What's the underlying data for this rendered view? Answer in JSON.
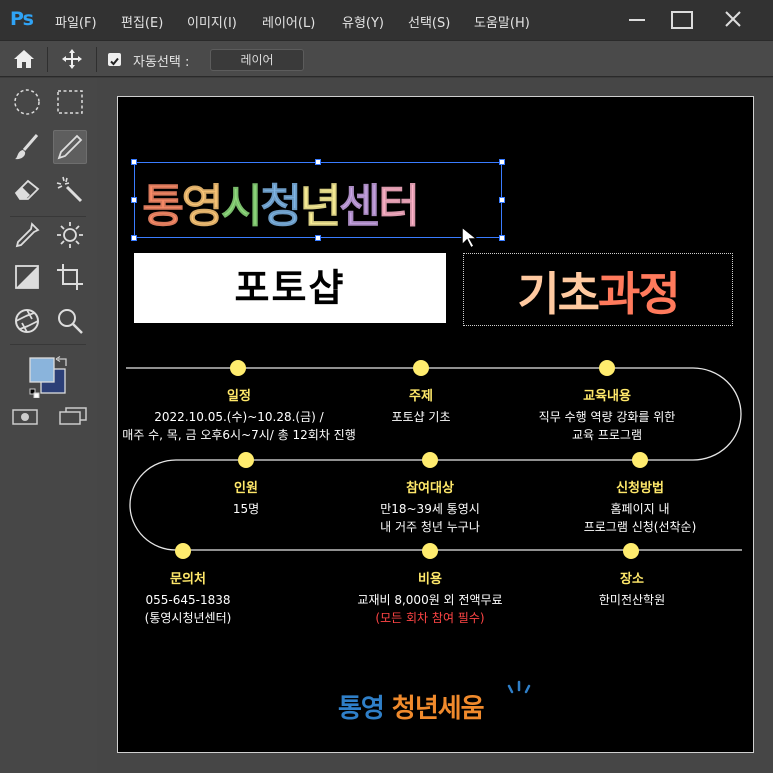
{
  "app": {
    "logo": "Ps"
  },
  "menu": [
    "파일(F)",
    "편집(E)",
    "이미지(I)",
    "레이어(L)",
    "유형(Y)",
    "선택(S)",
    "도움말(H)"
  ],
  "options": {
    "auto_select_label": "자동선택 :",
    "layer_select_value": "레이어"
  },
  "poster": {
    "title_chars": [
      {
        "t": "통",
        "color": "#ff8f6b"
      },
      {
        "t": "영",
        "color": "#ffc979"
      },
      {
        "t": "시",
        "color": "#8fdc7d"
      },
      {
        "t": "청",
        "color": "#7fb6e6"
      },
      {
        "t": "년",
        "color": "#fff49a"
      },
      {
        "t": "센",
        "color": "#c9a5e6"
      },
      {
        "t": "터",
        "color": "#ffb3c9"
      }
    ],
    "badge_left": "포토샵",
    "badge_right": [
      {
        "t": "기초",
        "color": "#ffc9a0"
      },
      {
        "t": "과정",
        "color": "#ff7a5c"
      }
    ],
    "timeline_items": {
      "schedule": {
        "title": "일정",
        "lines": [
          "2022.10.05.(수)~10.28.(금) /",
          "매주 수, 목, 금  오후6시~7시/ 총 12회차 진행"
        ]
      },
      "topic": {
        "title": "주제",
        "lines": [
          "포토샵 기초"
        ]
      },
      "content": {
        "title": "교육내용",
        "lines": [
          "직무 수행 역량 강화를 위한",
          "교육 프로그램"
        ]
      },
      "people": {
        "title": "인원",
        "lines": [
          "15명"
        ]
      },
      "target": {
        "title": "참여대상",
        "lines": [
          "만18~39세 통영시",
          "내 거주 청년 누구나"
        ]
      },
      "apply": {
        "title": "신청방법",
        "lines": [
          "홈페이지 내",
          "프로그램 신청(선착순)"
        ]
      },
      "contact": {
        "title": "문의처",
        "lines": [
          "055-645-1838",
          "(통영시청년센터)"
        ]
      },
      "cost": {
        "title": "비용",
        "lines": [
          "교재비 8,000원 외 전액무료"
        ],
        "note": "(모든 회차 참여 필수)"
      },
      "place": {
        "title": "장소",
        "lines": [
          "한미전산학원"
        ]
      }
    },
    "footer_logo": [
      {
        "t": "통영",
        "color": "#2f7fc8"
      },
      {
        "t": " 청년세움",
        "color": "#f08a2c"
      }
    ]
  }
}
